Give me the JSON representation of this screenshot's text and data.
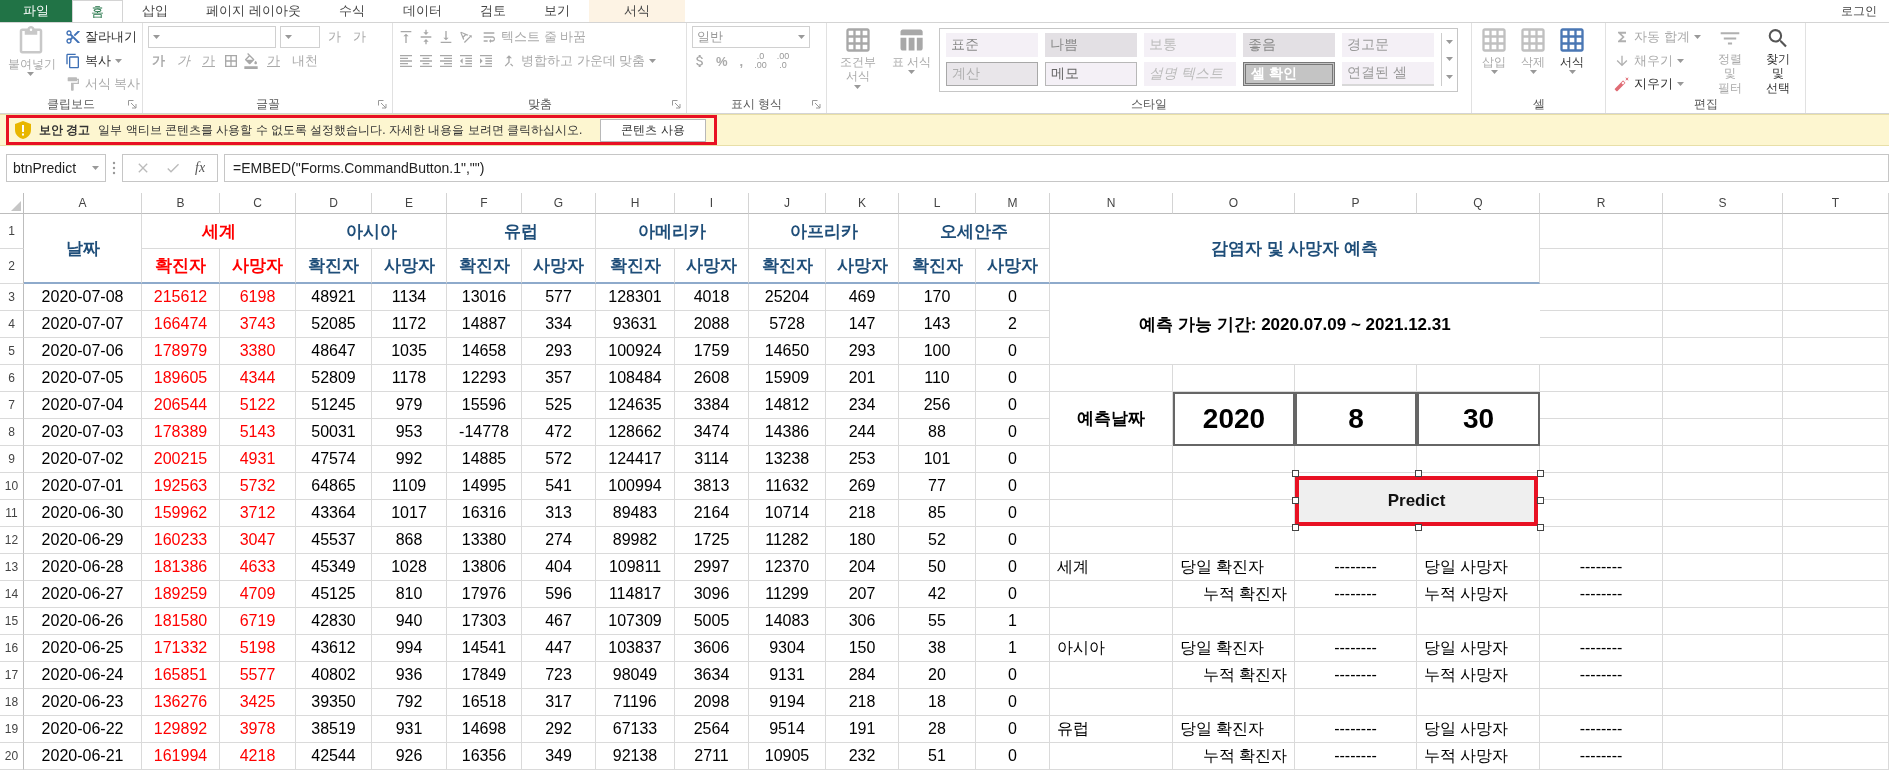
{
  "tabs": [
    {
      "label": "파일",
      "kind": "file",
      "selected": false
    },
    {
      "label": "홈",
      "kind": "normal",
      "selected": true
    },
    {
      "label": "삽입",
      "kind": "normal",
      "selected": false
    },
    {
      "label": "페이지 레이아웃",
      "kind": "normal",
      "selected": false
    },
    {
      "label": "수식",
      "kind": "normal",
      "selected": false
    },
    {
      "label": "데이터",
      "kind": "normal",
      "selected": false
    },
    {
      "label": "검토",
      "kind": "normal",
      "selected": false
    },
    {
      "label": "보기",
      "kind": "normal",
      "selected": false
    },
    {
      "label": "서식",
      "kind": "contextual",
      "selected": false
    }
  ],
  "account": "로그인",
  "ribbon": [
    {
      "kind": "clipboard",
      "label": "클립보드",
      "paste": "붙여넣기",
      "commands": [
        "잘라내기",
        "복사",
        "서식 복사"
      ]
    },
    {
      "kind": "font",
      "label": "글꼴",
      "grow": "가",
      "shrink": "가",
      "styles": [
        "가",
        "가",
        "가"
      ],
      "font_color": "가",
      "phonetic": "내천"
    },
    {
      "kind": "alignment",
      "label": "맞춤",
      "commands": [
        "텍스트 줄 바꿈",
        "병합하고 가운데 맞춤"
      ]
    },
    {
      "kind": "number",
      "label": "표시 형식",
      "format": "일반",
      "symbols": [
        "%",
        ","
      ],
      "decimals": [
        {
          "top": ".0",
          "bottom": ".00"
        },
        {
          "top": ".00",
          "bottom": ".0"
        }
      ]
    },
    {
      "kind": "styles",
      "label": "스타일",
      "commands": [
        "조건부 서식",
        "표 서식"
      ],
      "gallery": [
        {
          "label": "표준",
          "kind": "normal"
        },
        {
          "label": "나쁨",
          "kind": "bad"
        },
        {
          "label": "보통",
          "kind": "neutral"
        },
        {
          "label": "좋음",
          "kind": "good"
        },
        {
          "label": "경고문",
          "kind": "warning"
        },
        {
          "label": "계산",
          "kind": "calculation"
        },
        {
          "label": "메모",
          "kind": "note"
        },
        {
          "label": "설명 텍스트",
          "kind": "explanatory"
        },
        {
          "label": "셀 확인",
          "kind": "check"
        },
        {
          "label": "연결된 셀",
          "kind": "linked"
        }
      ]
    },
    {
      "kind": "cells",
      "label": "셀",
      "commands": [
        {
          "label": "삽입",
          "disabled": true
        },
        {
          "label": "삭제",
          "disabled": true
        },
        {
          "label": "서식",
          "disabled": false
        }
      ]
    },
    {
      "kind": "editing",
      "label": "편집",
      "commands": [
        {
          "label": "자동 합계",
          "disabled": true
        },
        {
          "label": "채우기",
          "disabled": true
        },
        {
          "label": "지우기",
          "disabled": false
        }
      ],
      "large": [
        {
          "label": "정렬 및 필터",
          "disabled": true
        },
        {
          "label": "찾기 및 선택",
          "disabled": false
        }
      ]
    }
  ],
  "warning": {
    "title": "보안 경고",
    "message": "일부 액티브 콘텐츠를 사용할 수 없도록 설정했습니다. 자세한 내용을 보려면 클릭하십시오.",
    "button": "콘텐츠 사용"
  },
  "formula_bar": {
    "name_box": "btnPredict",
    "function_label": "fx",
    "formula": "=EMBED(\"Forms.CommandButton.1\",\"\")"
  },
  "columns": [
    "A",
    "B",
    "C",
    "D",
    "E",
    "F",
    "G",
    "H",
    "I",
    "J",
    "K",
    "L",
    "M",
    "N",
    "O",
    "P",
    "Q",
    "R",
    "S",
    "T"
  ],
  "row_numbers": [
    "1",
    "2",
    "3",
    "4",
    "5",
    "6",
    "7",
    "8",
    "9",
    "10",
    "11",
    "12",
    "13",
    "14",
    "15",
    "16",
    "17",
    "18",
    "19",
    "20"
  ],
  "table": {
    "date_header": "날짜",
    "regions": [
      {
        "name": "세계",
        "color": "#ff0000",
        "highlighted": true,
        "columns": [
          "확진자",
          "사망자"
        ]
      },
      {
        "name": "아시아",
        "color": "#1f4e79",
        "highlighted": false,
        "columns": [
          "확진자",
          "사망자"
        ]
      },
      {
        "name": "유럽",
        "color": "#1f4e79",
        "highlighted": false,
        "columns": [
          "확진자",
          "사망자"
        ]
      },
      {
        "name": "아메리카",
        "color": "#1f4e79",
        "highlighted": false,
        "columns": [
          "확진자",
          "사망자"
        ]
      },
      {
        "name": "아프리카",
        "color": "#1f4e79",
        "highlighted": false,
        "columns": [
          "확진자",
          "사망자"
        ]
      },
      {
        "name": "오세안주",
        "color": "#1f4e79",
        "highlighted": false,
        "columns": [
          "확진자",
          "사망자"
        ]
      }
    ],
    "rows": [
      {
        "date": "2020-07-08",
        "values": [
          "215612",
          "6198",
          "48921",
          "1134",
          "13016",
          "577",
          "128301",
          "4018",
          "25204",
          "469",
          "170",
          "0"
        ]
      },
      {
        "date": "2020-07-07",
        "values": [
          "166474",
          "3743",
          "52085",
          "1172",
          "14887",
          "334",
          "93631",
          "2088",
          "5728",
          "147",
          "143",
          "2"
        ]
      },
      {
        "date": "2020-07-06",
        "values": [
          "178979",
          "3380",
          "48647",
          "1035",
          "14658",
          "293",
          "100924",
          "1759",
          "14650",
          "293",
          "100",
          "0"
        ]
      },
      {
        "date": "2020-07-05",
        "values": [
          "189605",
          "4344",
          "52809",
          "1178",
          "12293",
          "357",
          "108484",
          "2608",
          "15909",
          "201",
          "110",
          "0"
        ]
      },
      {
        "date": "2020-07-04",
        "values": [
          "206544",
          "5122",
          "51245",
          "979",
          "15596",
          "525",
          "124635",
          "3384",
          "14812",
          "234",
          "256",
          "0"
        ]
      },
      {
        "date": "2020-07-03",
        "values": [
          "178389",
          "5143",
          "50031",
          "953",
          "-14778",
          "472",
          "128662",
          "3474",
          "14386",
          "244",
          "88",
          "0"
        ]
      },
      {
        "date": "2020-07-02",
        "values": [
          "200215",
          "4931",
          "47574",
          "992",
          "14885",
          "572",
          "124417",
          "3114",
          "13238",
          "253",
          "101",
          "0"
        ]
      },
      {
        "date": "2020-07-01",
        "values": [
          "192563",
          "5732",
          "64865",
          "1109",
          "14995",
          "541",
          "100994",
          "3813",
          "11632",
          "269",
          "77",
          "0"
        ]
      },
      {
        "date": "2020-06-30",
        "values": [
          "159962",
          "3712",
          "43364",
          "1017",
          "16316",
          "313",
          "89483",
          "2164",
          "10714",
          "218",
          "85",
          "0"
        ]
      },
      {
        "date": "2020-06-29",
        "values": [
          "160233",
          "3047",
          "45537",
          "868",
          "13380",
          "274",
          "89982",
          "1725",
          "11282",
          "180",
          "52",
          "0"
        ]
      },
      {
        "date": "2020-06-28",
        "values": [
          "181386",
          "4633",
          "45349",
          "1028",
          "13806",
          "404",
          "109811",
          "2997",
          "12370",
          "204",
          "50",
          "0"
        ]
      },
      {
        "date": "2020-06-27",
        "values": [
          "189259",
          "4709",
          "45125",
          "810",
          "17976",
          "596",
          "114817",
          "3096",
          "11299",
          "207",
          "42",
          "0"
        ]
      },
      {
        "date": "2020-06-26",
        "values": [
          "181580",
          "6719",
          "42830",
          "940",
          "17303",
          "467",
          "107309",
          "5005",
          "14083",
          "306",
          "55",
          "1"
        ]
      },
      {
        "date": "2020-06-25",
        "values": [
          "171332",
          "5198",
          "43612",
          "994",
          "14541",
          "447",
          "103837",
          "3606",
          "9304",
          "150",
          "38",
          "1"
        ]
      },
      {
        "date": "2020-06-24",
        "values": [
          "165851",
          "5577",
          "40802",
          "936",
          "17849",
          "723",
          "98049",
          "3634",
          "9131",
          "284",
          "20",
          "0"
        ]
      },
      {
        "date": "2020-06-23",
        "values": [
          "136276",
          "3425",
          "39350",
          "792",
          "16518",
          "317",
          "71196",
          "2098",
          "9194",
          "218",
          "18",
          "0"
        ]
      },
      {
        "date": "2020-06-22",
        "values": [
          "129892",
          "3978",
          "38519",
          "931",
          "14698",
          "292",
          "67133",
          "2564",
          "9514",
          "191",
          "28",
          "0"
        ]
      },
      {
        "date": "2020-06-21",
        "values": [
          "161994",
          "4218",
          "42544",
          "926",
          "16356",
          "349",
          "92138",
          "2711",
          "10905",
          "232",
          "51",
          "0"
        ]
      }
    ]
  },
  "panel": {
    "title": "감염자 및 사망자 예측",
    "period": "예측 가능 기간: 2020.07.09 ~ 2021.12.31",
    "date_label": "예측날짜",
    "date_inputs": [
      "2020",
      "8",
      "30"
    ],
    "button": "Predict",
    "results": [
      {
        "region": "세계",
        "rows": [
          {
            "kind": "daily",
            "case_label": "당일 확진자",
            "case_value": "--------",
            "death_label": "당일 사망자",
            "death_value": "--------"
          },
          {
            "kind": "cumulative",
            "case_label": "누적 확진자",
            "case_value": "--------",
            "death_label": "누적 사망자",
            "death_value": "--------"
          }
        ]
      },
      {
        "region": "아시아",
        "rows": [
          {
            "kind": "daily",
            "case_label": "당일 확진자",
            "case_value": "--------",
            "death_label": "당일 사망자",
            "death_value": "--------"
          },
          {
            "kind": "cumulative",
            "case_label": "누적 확진자",
            "case_value": "--------",
            "death_label": "누적 사망자",
            "death_value": "--------"
          }
        ]
      },
      {
        "region": "유럽",
        "rows": [
          {
            "kind": "daily",
            "case_label": "당일 확진자",
            "case_value": "--------",
            "death_label": "당일 사망자",
            "death_value": "--------"
          },
          {
            "kind": "cumulative",
            "case_label": "누적 확진자",
            "case_value": "--------",
            "death_label": "누적 사망자",
            "death_value": "--------"
          }
        ]
      }
    ]
  }
}
